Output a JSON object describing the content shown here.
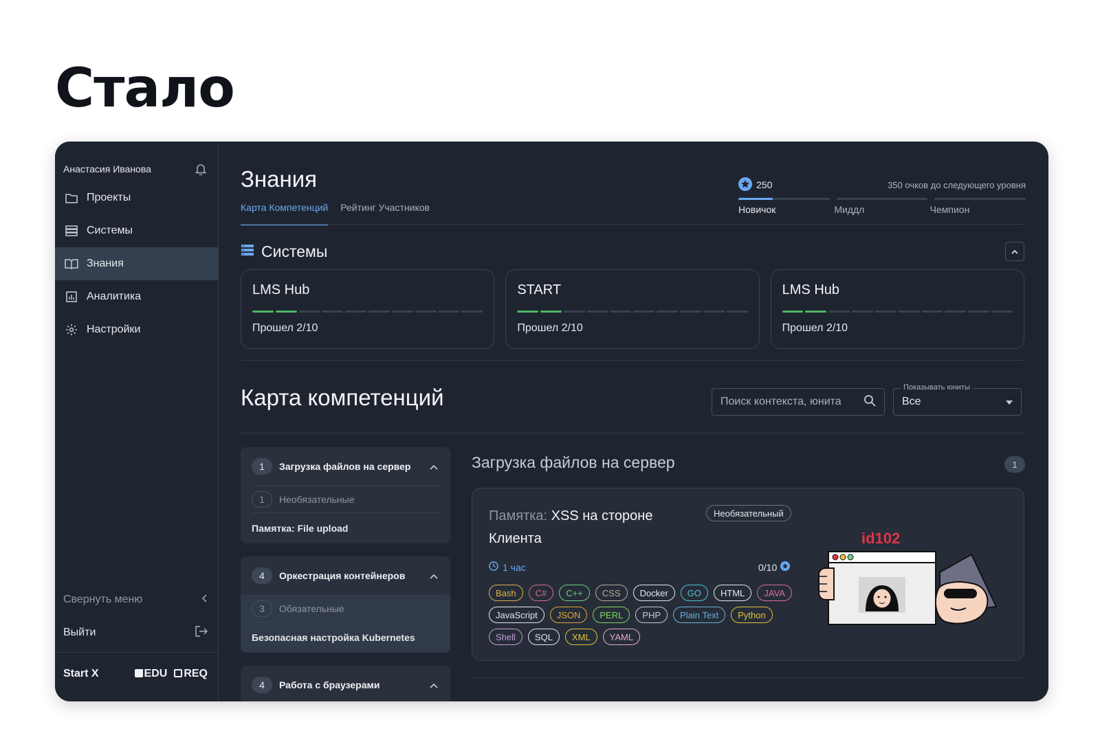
{
  "slide_title": "Стало",
  "sidebar": {
    "user_name": "Анастасия Иванова",
    "items": [
      {
        "label": "Проекты",
        "icon": "folder-icon"
      },
      {
        "label": "Системы",
        "icon": "server-icon"
      },
      {
        "label": "Знания",
        "icon": "book-icon",
        "active": true
      },
      {
        "label": "Аналитика",
        "icon": "chart-icon"
      },
      {
        "label": "Настройки",
        "icon": "gear-icon"
      }
    ],
    "collapse_label": "Свернуть меню",
    "logout_label": "Выйти",
    "brands": [
      "Start X",
      "EDU",
      "REQ"
    ]
  },
  "header": {
    "title": "Знания",
    "tabs": [
      {
        "label": "Карта Компетенций",
        "active": true
      },
      {
        "label": "Рейтинг Участников",
        "active": false
      }
    ]
  },
  "level": {
    "points": "250",
    "to_next": "350 очков до следующего уровня",
    "levels": [
      "Новичок",
      "Миддл",
      "Чемпион"
    ],
    "current_level_progress": 0.38
  },
  "systems": {
    "title": "Системы",
    "cards": [
      {
        "name": "LMS Hub",
        "passed_label": "Прошел 2/10",
        "done": 2,
        "total": 10
      },
      {
        "name": "START",
        "passed_label": "Прошел 2/10",
        "done": 2,
        "total": 10
      },
      {
        "name": "LMS Hub",
        "passed_label": "Прошел 2/10",
        "done": 2,
        "total": 10
      }
    ]
  },
  "competency": {
    "title": "Карта компетенций",
    "search_placeholder": "Поиск контекста, юнита",
    "filter_legend": "Показывать юниты",
    "filter_value": "Все"
  },
  "accordion": [
    {
      "count": "1",
      "title": "Загрузка файлов на сервер",
      "sub_count": "1",
      "sub_label": "Необязательные",
      "item": "Памятка: File upload"
    },
    {
      "count": "4",
      "title": "Оркестрация контейнеров",
      "sub_count": "3",
      "sub_label": "Обязательные",
      "item": "Безопасная настройка Kubernetes"
    },
    {
      "count": "4",
      "title": "Работа с браузерами"
    }
  ],
  "section": {
    "title": "Загрузка файлов на сервер",
    "count": "1"
  },
  "card": {
    "prefix": "Памятка:",
    "title": "XSS на стороне Клиента",
    "badge": "Необязательный",
    "time": "1 час",
    "score": "0/10",
    "illustration_text": "id102",
    "tags": [
      {
        "label": "Bash",
        "color": "#d9b34a"
      },
      {
        "label": "C#",
        "color": "#d96a8a"
      },
      {
        "label": "C++",
        "color": "#6fcf8a"
      },
      {
        "label": "CSS",
        "color": "#b8a99a"
      },
      {
        "label": "Docker",
        "color": "#e6e8ec"
      },
      {
        "label": "GO",
        "color": "#4fc3d9"
      },
      {
        "label": "HTML",
        "color": "#e6e8ec"
      },
      {
        "label": "JAVA",
        "color": "#d96aa8"
      },
      {
        "label": "JavaScript",
        "color": "#e6e8ec"
      },
      {
        "label": "JSON",
        "color": "#e0a83a"
      },
      {
        "label": "PERL",
        "color": "#7ed957"
      },
      {
        "label": "PHP",
        "color": "#c8ccd3"
      },
      {
        "label": "Plain Text",
        "color": "#6ab0d9"
      },
      {
        "label": "Python",
        "color": "#e0c23a"
      },
      {
        "label": "Shell",
        "color": "#c89ad9"
      },
      {
        "label": "SQL",
        "color": "#e6e8ec"
      },
      {
        "label": "XML",
        "color": "#e0c23a"
      },
      {
        "label": "YAML",
        "color": "#e6a8c8"
      }
    ]
  }
}
